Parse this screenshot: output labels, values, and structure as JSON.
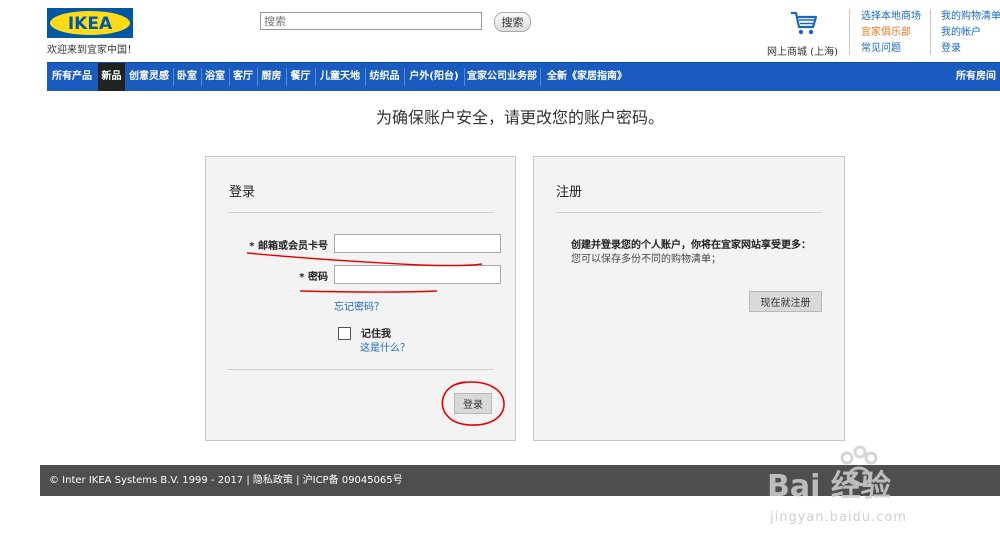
{
  "header": {
    "logo_text": "IKEA",
    "welcome": "欢迎来到宜家中国！",
    "search_placeholder": "搜索",
    "search_button": "搜索",
    "online_store": "网上商城 (上海)",
    "links_col1": [
      "选择本地商场",
      "宜家俱乐部",
      "常见问题"
    ],
    "links_col2": [
      "我的购物清单",
      "我的帐户",
      "登录"
    ]
  },
  "nav": {
    "items": [
      "所有产品",
      "新品",
      "创意灵感",
      "卧室",
      "浴室",
      "客厅",
      "厨房",
      "餐厅",
      "儿童天地",
      "纺织品",
      "户外(阳台)",
      "宜家公司业务部",
      "全新《家居指南》"
    ],
    "right_item": "所有房间"
  },
  "page_title": "为确保账户安全，请更改您的账户密码。",
  "login": {
    "title": "登录",
    "email_label": "* 邮箱或会员卡号",
    "password_label": "* 密码",
    "forgot_password": "忘记密码？",
    "remember_me": "记住我",
    "whats_this": "这是什么？",
    "submit": "登录"
  },
  "register": {
    "title": "注册",
    "heading": "创建并登录您的个人账户，你将在宜家网站享受更多：",
    "desc": "您可以保存多份不同的购物清单；",
    "button": "现在就注册"
  },
  "footer": {
    "text": "© Inter IKEA Systems B.V. 1999 - 2017 | 隐私政策 | 沪ICP备 09045065号"
  },
  "watermark": {
    "brand": "Bai 经验",
    "url": "jingyan.baidu.com"
  },
  "colors": {
    "nav_blue": "#1a5bbf",
    "ikea_yellow": "#ffda1a",
    "ikea_blue": "#0058a3",
    "link_blue": "#1a68c1",
    "annotation_red": "#e60000"
  }
}
